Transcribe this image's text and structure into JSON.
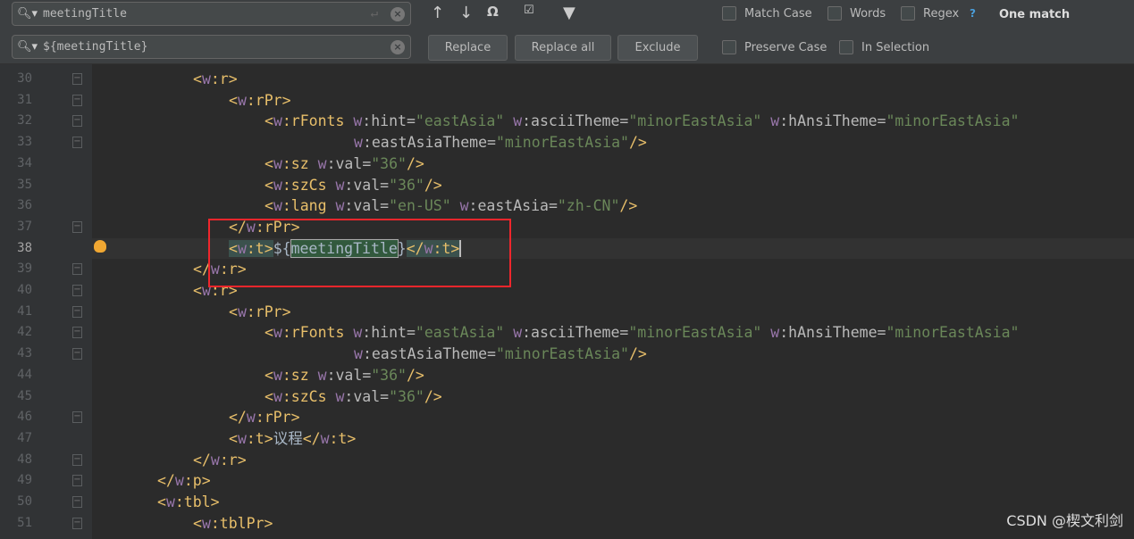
{
  "find": {
    "search_value": "meetingTitle",
    "replace_value": "${meetingTitle}",
    "replace_label": "Replace",
    "replace_all_label": "Replace all",
    "exclude_label": "Exclude",
    "options": {
      "match_case": "Match Case",
      "words": "Words",
      "regex": "Regex",
      "regex_help": "?",
      "preserve_case": "Preserve Case",
      "in_selection": "In Selection"
    },
    "status": "One match",
    "icons": [
      "search-icon",
      "enter-icon",
      "clear-icon",
      "previous-occurrence-icon",
      "next-occurrence-icon",
      "select-all-occurrences-icon",
      "filter-icon"
    ]
  },
  "editor": {
    "current_line": 38,
    "highlight_box_color": "#f0262c",
    "lines": [
      {
        "n": 30,
        "i": 8,
        "code": "<w:r>",
        "fold": true
      },
      {
        "n": 31,
        "i": 12,
        "code": "<w:rPr>",
        "fold": true
      },
      {
        "n": 32,
        "i": 16,
        "code": "<w:rFonts w:hint=\"eastAsia\" w:asciiTheme=\"minorEastAsia\" w:hAnsiTheme=\"minorEastAsia\"",
        "fold": true
      },
      {
        "n": 33,
        "i": 26,
        "code": "w:eastAsiaTheme=\"minorEastAsia\"/>",
        "fold": true
      },
      {
        "n": 34,
        "i": 16,
        "code": "<w:sz w:val=\"36\"/>"
      },
      {
        "n": 35,
        "i": 16,
        "code": "<w:szCs w:val=\"36\"/>"
      },
      {
        "n": 36,
        "i": 16,
        "code": "<w:lang w:val=\"en-US\" w:eastAsia=\"zh-CN\"/>"
      },
      {
        "n": 37,
        "i": 12,
        "code": "</w:rPr>",
        "fold": true
      },
      {
        "n": 38,
        "i": 12,
        "code": "<w:t>${meetingTitle}</w:t>",
        "bulb": true
      },
      {
        "n": 39,
        "i": 8,
        "code": "</w:r>",
        "fold": true
      },
      {
        "n": 40,
        "i": 8,
        "code": "<w:r>",
        "fold": true
      },
      {
        "n": 41,
        "i": 12,
        "code": "<w:rPr>",
        "fold": true
      },
      {
        "n": 42,
        "i": 16,
        "code": "<w:rFonts w:hint=\"eastAsia\" w:asciiTheme=\"minorEastAsia\" w:hAnsiTheme=\"minorEastAsia\"",
        "fold": true
      },
      {
        "n": 43,
        "i": 26,
        "code": "w:eastAsiaTheme=\"minorEastAsia\"/>",
        "fold": true
      },
      {
        "n": 44,
        "i": 16,
        "code": "<w:sz w:val=\"36\"/>"
      },
      {
        "n": 45,
        "i": 16,
        "code": "<w:szCs w:val=\"36\"/>"
      },
      {
        "n": 46,
        "i": 12,
        "code": "</w:rPr>",
        "fold": true
      },
      {
        "n": 47,
        "i": 12,
        "code": "<w:t>议程</w:t>"
      },
      {
        "n": 48,
        "i": 8,
        "code": "</w:r>",
        "fold": true
      },
      {
        "n": 49,
        "i": 4,
        "code": "</w:p>",
        "fold": true
      },
      {
        "n": 50,
        "i": 4,
        "code": "<w:tbl>",
        "fold": true
      },
      {
        "n": 51,
        "i": 8,
        "code": "<w:tblPr>",
        "fold": true
      }
    ]
  },
  "watermark": "CSDN @楔文利剑"
}
